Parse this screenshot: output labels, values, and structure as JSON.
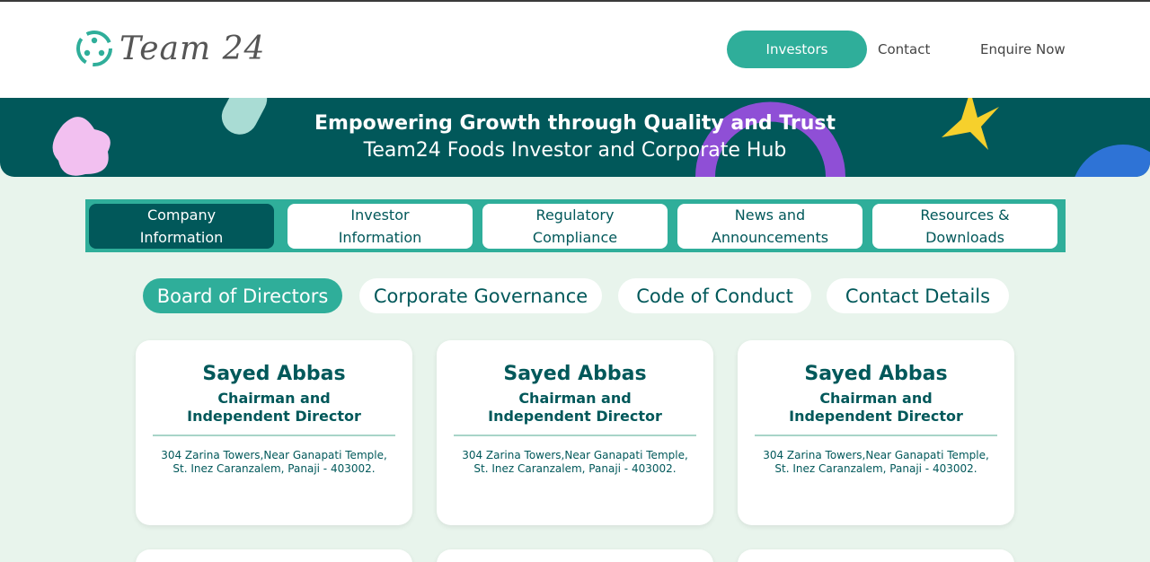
{
  "header": {
    "logo_text": "Team 24",
    "nav": [
      {
        "label": "Investors",
        "active": true
      },
      {
        "label": "Contact",
        "active": false
      },
      {
        "label": "Enquire Now",
        "active": false
      }
    ]
  },
  "hero": {
    "title": "Empowering Growth through Quality and Trust",
    "subtitle": "Team24 Foods Investor and Corporate Hub"
  },
  "tabs": [
    {
      "line1": "Company",
      "line2": "Information",
      "active": true
    },
    {
      "line1": "Investor",
      "line2": "Information",
      "active": false
    },
    {
      "line1": "Regulatory",
      "line2": "Compliance",
      "active": false
    },
    {
      "line1": "News and",
      "line2": "Announcements",
      "active": false
    },
    {
      "line1": "Resources &",
      "line2": "Downloads",
      "active": false
    }
  ],
  "subtabs": [
    {
      "label": "Board of Directors",
      "active": true
    },
    {
      "label": "Corporate Governance",
      "active": false
    },
    {
      "label": "Code of Conduct",
      "active": false
    },
    {
      "label": "Contact Details",
      "active": false
    }
  ],
  "directors": [
    {
      "name": "Sayed Abbas",
      "role_line1": "Chairman and",
      "role_line2": "Independent Director",
      "address_line1": "304 Zarina Towers,Near Ganapati Temple,",
      "address_line2": "St. Inez Caranzalem, Panaji - 403002."
    },
    {
      "name": "Sayed Abbas",
      "role_line1": "Chairman and",
      "role_line2": "Independent Director",
      "address_line1": "304 Zarina Towers,Near Ganapati Temple,",
      "address_line2": "St. Inez Caranzalem, Panaji - 403002."
    },
    {
      "name": "Sayed Abbas",
      "role_line1": "Chairman and",
      "role_line2": "Independent Director",
      "address_line1": "304 Zarina Towers,Near Ganapati Temple,",
      "address_line2": "St. Inez Caranzalem, Panaji - 403002."
    }
  ],
  "colors": {
    "brand_dark": "#01585a",
    "brand_accent": "#2fae9a",
    "page_bg": "#e8f4ec"
  }
}
